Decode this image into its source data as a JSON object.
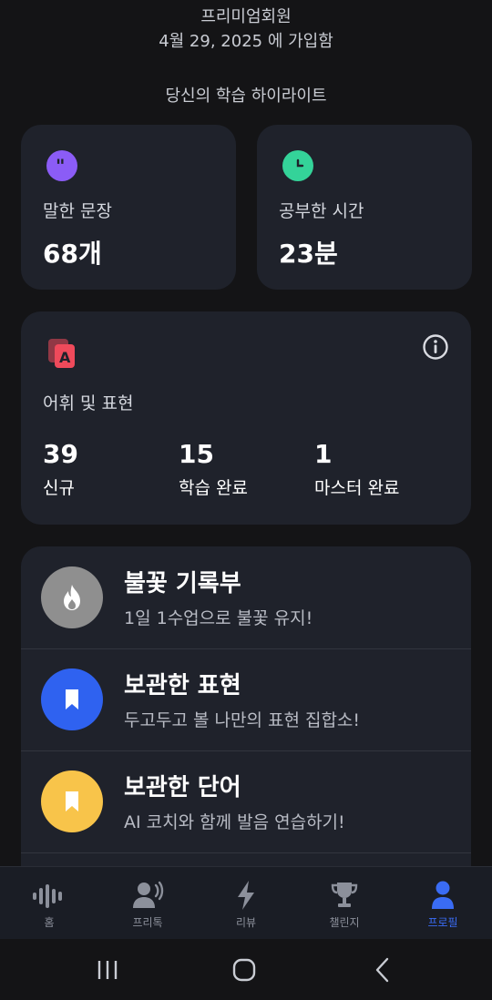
{
  "header": {
    "member_type": "프리미엄회원",
    "joined": "4월 29, 2025  에 가입함",
    "highlights_title": "당신의 학습 하이라이트"
  },
  "stats": {
    "sentences": {
      "label": "말한 문장",
      "value": "68개",
      "icon": "quote-bubble-icon",
      "color": "#8b5cf6"
    },
    "time": {
      "label": "공부한 시간",
      "value": "23분",
      "icon": "clock-icon",
      "color": "#34d399"
    }
  },
  "vocab": {
    "title": "어휘 및 표현",
    "icon_color": "#ef4a5b",
    "items": [
      {
        "number": "39",
        "caption": "신규"
      },
      {
        "number": "15",
        "caption": "학습 완료"
      },
      {
        "number": "1",
        "caption": "마스터 완료"
      }
    ]
  },
  "list": [
    {
      "title": "불꽃 기록부",
      "subtitle": "1일 1수업으로 불꽃 유지!",
      "icon": "fire-icon",
      "color": "#8f8f8f"
    },
    {
      "title": "보관한 표현",
      "subtitle": "두고두고 볼 나만의 표현 집합소!",
      "icon": "bookmark-icon",
      "color": "#2f62f0"
    },
    {
      "title": "보관한 단어",
      "subtitle": "AI 코치와 함께 발음 연습하기!",
      "icon": "bookmark-icon",
      "color": "#f8c44a"
    }
  ],
  "tabs": [
    {
      "label": "홈",
      "icon": "waveform-icon"
    },
    {
      "label": "프리톡",
      "icon": "speaking-person-icon"
    },
    {
      "label": "리뷰",
      "icon": "lightning-icon"
    },
    {
      "label": "챌린지",
      "icon": "trophy-icon"
    },
    {
      "label": "프로필",
      "icon": "person-icon",
      "active": true
    }
  ],
  "colors": {
    "accent": "#3a6cf4",
    "card": "#1f222b",
    "background": "#141416"
  }
}
